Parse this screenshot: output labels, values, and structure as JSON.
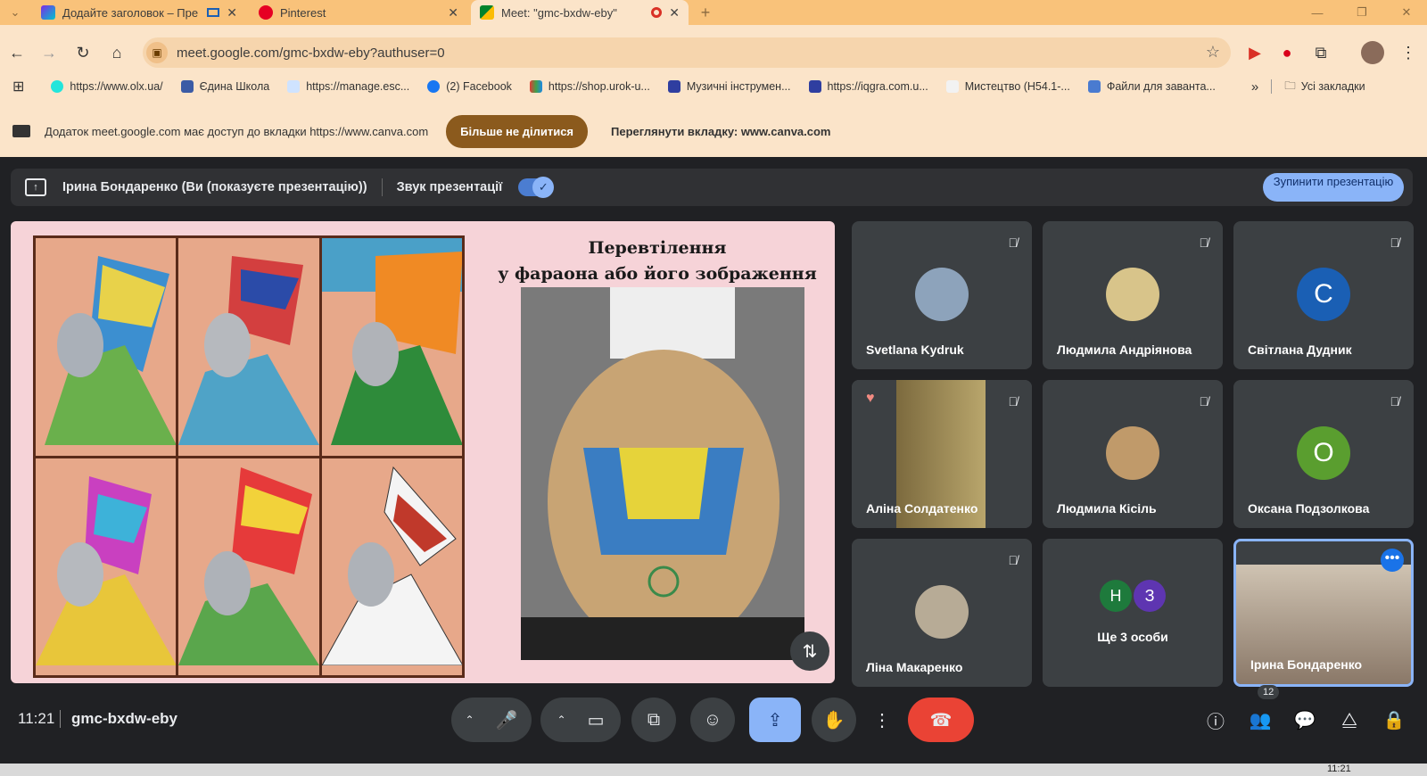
{
  "browser": {
    "tabs": [
      {
        "title": "Додайте заголовок – Пре",
        "active": false
      },
      {
        "title": "Pinterest",
        "active": false
      },
      {
        "title": "Meet: \"gmc-bxdw-eby\"",
        "active": true
      }
    ],
    "new_tab": "+",
    "url": "meet.google.com/gmc-bxdw-eby?authuser=0",
    "bookmarks": [
      "https://www.olx.ua/",
      "Єдина Школа",
      "https://manage.esc...",
      "(2) Facebook",
      "https://shop.urok-u...",
      "Музичні інструмен...",
      "https://iqgra.com.u...",
      "Мистецтво (Н54.1-...",
      "Файли для заванта..."
    ],
    "bookmarks_more": "»",
    "all_bookmarks": "Усі закладки",
    "info_text": "Додаток meet.google.com має доступ до вкладки https://www.canva.com",
    "stop_sharing": "Більше не ділитися",
    "view_tab": "Переглянути вкладку: www.canva.com"
  },
  "meet": {
    "presenting_text": "Ірина Бондаренко (Ви (показуєте презентацію))",
    "audio_label": "Звук презентації",
    "audio_on": true,
    "stop_presenting": "Зупинити презентацію",
    "slide": {
      "title_line1": "Перевтілення",
      "title_line2": "у фараона або його зображення"
    },
    "participants": [
      {
        "name": "Svetlana Kydruk",
        "muted": true
      },
      {
        "name": "Людмила Андріянова",
        "muted": true
      },
      {
        "name": "Світлана Дудник",
        "initial": "С",
        "muted": true
      },
      {
        "name": "Аліна Солдатенко",
        "muted": true,
        "reaction": "heart"
      },
      {
        "name": "Людмила Кісіль",
        "muted": true
      },
      {
        "name": "Оксана Подзолкова",
        "initial": "О",
        "muted": true
      },
      {
        "name": "Ліна Макаренко",
        "muted": true
      },
      {
        "name": "Ще 3 особи",
        "initials": [
          "Н",
          "З"
        ]
      },
      {
        "name": "Ірина Бондаренко",
        "self": true
      }
    ],
    "colors": {
      "accent": "#8ab4f8",
      "end_call": "#ea4335",
      "tile": "#3c4043",
      "bg": "#202124"
    },
    "clock": "11:21",
    "meeting_code": "gmc-bxdw-eby",
    "people_count": "12"
  },
  "taskbar": {
    "time": "11:21"
  }
}
